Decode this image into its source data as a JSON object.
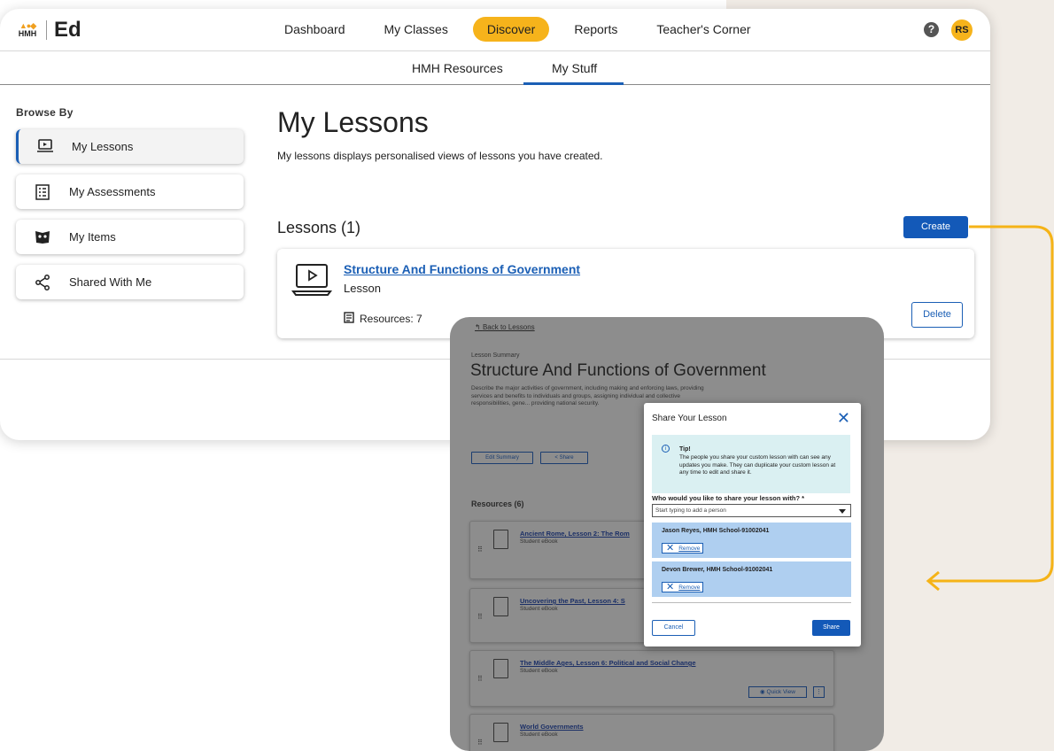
{
  "app": {
    "logo_text": "HMH",
    "name": "Ed"
  },
  "nav": {
    "items": [
      "Dashboard",
      "My Classes",
      "Discover",
      "Reports",
      "Teacher's Corner"
    ],
    "active": "Discover"
  },
  "user": {
    "initials": "RS",
    "help": "?"
  },
  "subnav": {
    "items": [
      "HMH Resources",
      "My Stuff"
    ],
    "active": "My Stuff"
  },
  "sidebar": {
    "heading": "Browse By",
    "items": [
      {
        "label": "My Lessons",
        "icon": "laptop-icon",
        "active": true
      },
      {
        "label": "My Assessments",
        "icon": "checklist-icon",
        "active": false
      },
      {
        "label": "My Items",
        "icon": "items-icon",
        "active": false
      },
      {
        "label": "Shared With Me",
        "icon": "share-icon",
        "active": false
      }
    ]
  },
  "main": {
    "title": "My Lessons",
    "description": "My lessons displays personalised views of lessons you have created.",
    "lessons_heading": "Lessons (1)",
    "create_label": "Create",
    "lesson": {
      "title": "Structure And Functions of Government",
      "type": "Lesson",
      "resources": "Resources: 7",
      "delete_label": "Delete"
    }
  },
  "overlay": {
    "back": "Back to Lessons",
    "summary_label": "Lesson Summary",
    "title": "Structure And Functions of Government",
    "description": "Describe the major activities of government, including making and enforcing laws, providing services and benefits to individuals and groups, assigning individual and collective responsibilities, gene... providing national security.",
    "edit_summary": "Edit Summary",
    "share": "Share",
    "resources_heading": "Resources (6)",
    "resources": [
      {
        "title": "Ancient Rome, Lesson 2: The Rom",
        "type": "Student eBook"
      },
      {
        "title": "Uncovering the Past, Lesson 4: S",
        "type": "Student eBook"
      },
      {
        "title": "The Middle Ages, Lesson 6: Political and Social Change",
        "type": "Student eBook"
      },
      {
        "title": "World Governments",
        "type": "Student eBook"
      }
    ],
    "quick_view": "Quick View"
  },
  "modal": {
    "title": "Share Your Lesson",
    "tip_heading": "Tip!",
    "tip_text": "The people you share your custom lesson with can see any updates you make. They can duplicate your custom lesson at any time to edit and share it.",
    "question": "Who would you like to share your lesson with? *",
    "input_placeholder": "Start typing to add a person",
    "people": [
      {
        "name": "Jason Reyes, HMH School-91002041",
        "remove": "Remove"
      },
      {
        "name": "Devon Brewer, HMH School-91002041",
        "remove": "Remove"
      }
    ],
    "cancel": "Cancel",
    "share": "Share"
  },
  "colors": {
    "accent": "#1359b8",
    "highlight": "#f6b31b",
    "overlay": "#8d8d8d",
    "tip_bg": "#daf0f2",
    "person_bg": "#afcff0"
  }
}
